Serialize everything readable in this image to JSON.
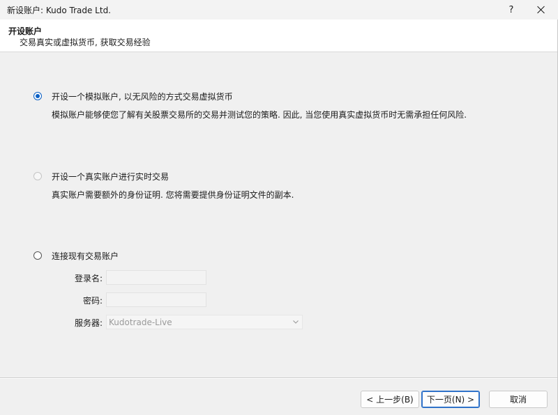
{
  "window": {
    "title": "新设账户: Kudo Trade Ltd.",
    "help_label": "?",
    "close_icon": "close-icon"
  },
  "header": {
    "title": "开设账户",
    "subtitle": "交易真实或虚拟货币, 获取交易经验"
  },
  "options": [
    {
      "label": "开设一个模拟账户, 以无风险的方式交易虚拟货币",
      "description": "模拟账户能够使您了解有关股票交易所的交易并测试您的策略. 因此, 当您使用真实虚拟货币时无需承担任何风险.",
      "selected": true,
      "enabled": true
    },
    {
      "label": "开设一个真实账户进行实时交易",
      "description": "真实账户需要额外的身份证明. 您将需要提供身份证明文件的副本.",
      "selected": false,
      "enabled": false
    },
    {
      "label": "连接现有交易账户",
      "selected": false,
      "enabled": true
    }
  ],
  "existing_account": {
    "login_label": "登录名:",
    "login_value": "",
    "password_label": "密码:",
    "password_value": "",
    "server_label": "服务器:",
    "server_value": "Kudotrade-Live"
  },
  "buttons": {
    "back": "< 上一步(B)",
    "next": "下一页(N) >",
    "cancel": "取消"
  },
  "colors": {
    "accent": "#0a5fc4",
    "header_bg": "#ffffff",
    "body_bg": "#f0f0f0"
  }
}
